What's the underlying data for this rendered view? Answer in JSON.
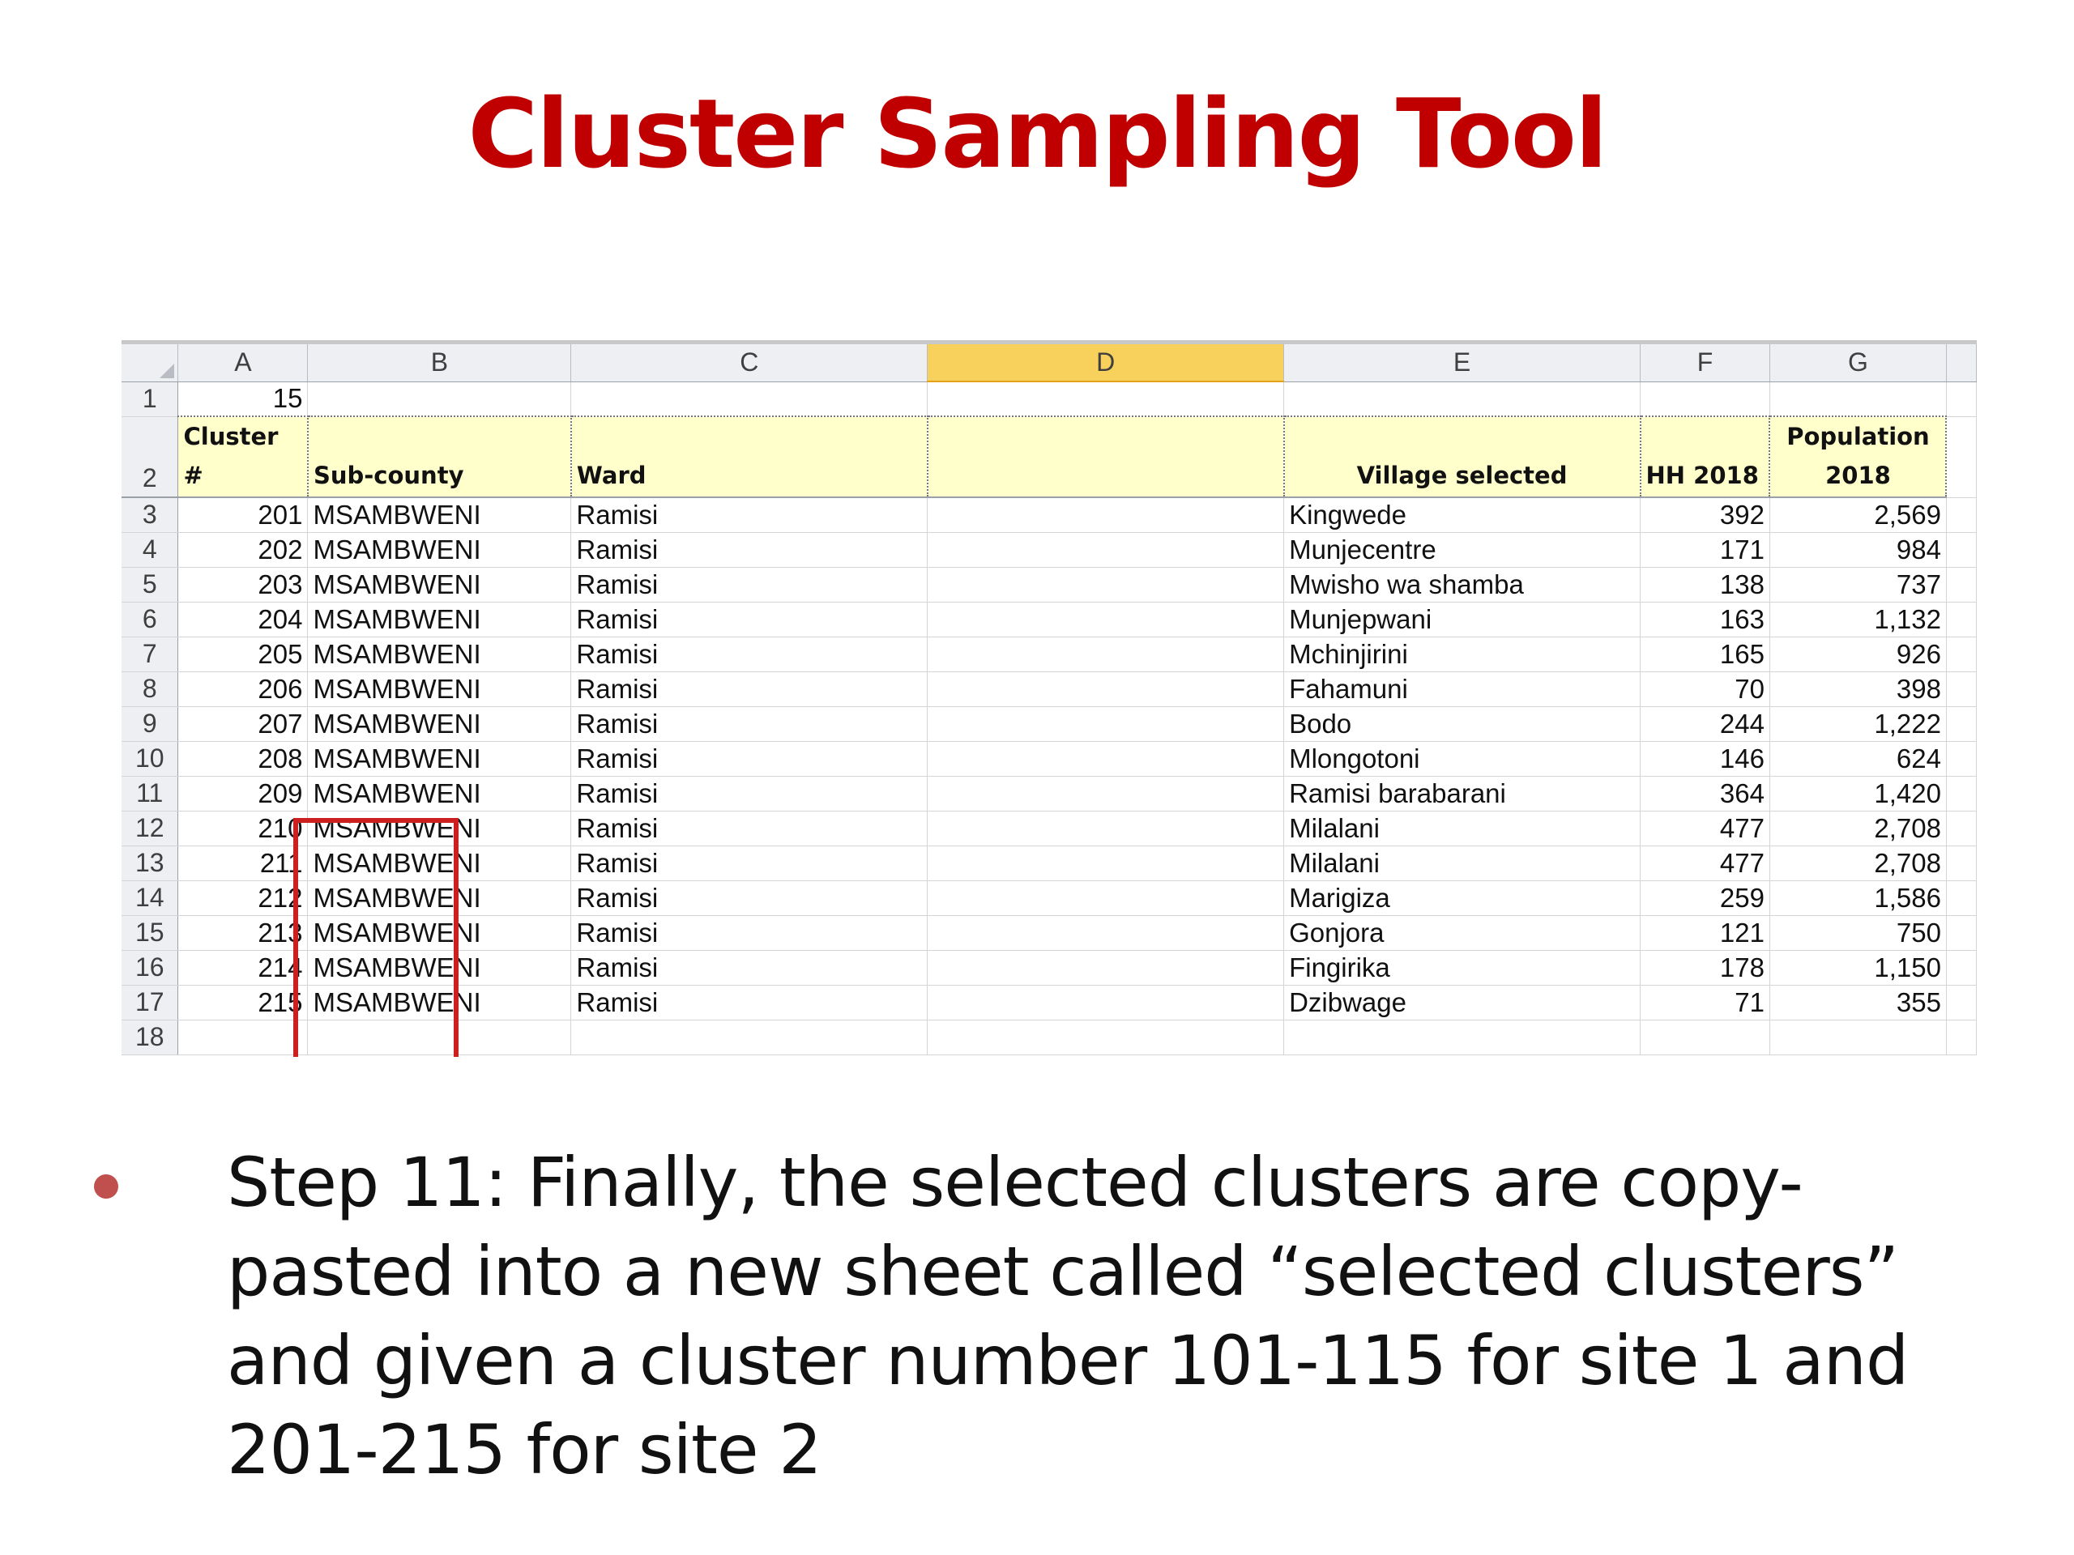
{
  "slide": {
    "title": "Cluster Sampling Tool"
  },
  "spreadsheet": {
    "columns": [
      "A",
      "B",
      "C",
      "D",
      "E",
      "F",
      "G"
    ],
    "selected_column": "D",
    "row1": {
      "row_number": "1",
      "a_value": "15"
    },
    "header_row": {
      "row_number": "2",
      "cluster": "Cluster #",
      "subcounty": "Sub-county",
      "ward": "Ward",
      "blank": "",
      "village": "Village selected",
      "hh": "HH 2018",
      "population": "Population 2018"
    },
    "rows": [
      {
        "row_number": "3",
        "cluster": "201",
        "subcounty": "MSAMBWENI",
        "ward": "Ramisi",
        "village": "Kingwede",
        "hh": "392",
        "population": "2,569"
      },
      {
        "row_number": "4",
        "cluster": "202",
        "subcounty": "MSAMBWENI",
        "ward": "Ramisi",
        "village": "Munjecentre",
        "hh": "171",
        "population": "984"
      },
      {
        "row_number": "5",
        "cluster": "203",
        "subcounty": "MSAMBWENI",
        "ward": "Ramisi",
        "village": "Mwisho wa shamba",
        "hh": "138",
        "population": "737"
      },
      {
        "row_number": "6",
        "cluster": "204",
        "subcounty": "MSAMBWENI",
        "ward": "Ramisi",
        "village": "Munjepwani",
        "hh": "163",
        "population": "1,132"
      },
      {
        "row_number": "7",
        "cluster": "205",
        "subcounty": "MSAMBWENI",
        "ward": "Ramisi",
        "village": "Mchinjirini",
        "hh": "165",
        "population": "926"
      },
      {
        "row_number": "8",
        "cluster": "206",
        "subcounty": "MSAMBWENI",
        "ward": "Ramisi",
        "village": "Fahamuni",
        "hh": "70",
        "population": "398"
      },
      {
        "row_number": "9",
        "cluster": "207",
        "subcounty": "MSAMBWENI",
        "ward": "Ramisi",
        "village": "Bodo",
        "hh": "244",
        "population": "1,222"
      },
      {
        "row_number": "10",
        "cluster": "208",
        "subcounty": "MSAMBWENI",
        "ward": "Ramisi",
        "village": "Mlongotoni",
        "hh": "146",
        "population": "624"
      },
      {
        "row_number": "11",
        "cluster": "209",
        "subcounty": "MSAMBWENI",
        "ward": "Ramisi",
        "village": "Ramisi barabarani",
        "hh": "364",
        "population": "1,420"
      },
      {
        "row_number": "12",
        "cluster": "210",
        "subcounty": "MSAMBWENI",
        "ward": "Ramisi",
        "village": "Milalani",
        "hh": "477",
        "population": "2,708"
      },
      {
        "row_number": "13",
        "cluster": "211",
        "subcounty": "MSAMBWENI",
        "ward": "Ramisi",
        "village": "Milalani",
        "hh": "477",
        "population": "2,708"
      },
      {
        "row_number": "14",
        "cluster": "212",
        "subcounty": "MSAMBWENI",
        "ward": "Ramisi",
        "village": "Marigiza",
        "hh": "259",
        "population": "1,586"
      },
      {
        "row_number": "15",
        "cluster": "213",
        "subcounty": "MSAMBWENI",
        "ward": "Ramisi",
        "village": "Gonjora",
        "hh": "121",
        "population": "750"
      },
      {
        "row_number": "16",
        "cluster": "214",
        "subcounty": "MSAMBWENI",
        "ward": "Ramisi",
        "village": "Fingirika",
        "hh": "178",
        "population": "1,150"
      },
      {
        "row_number": "17",
        "cluster": "215",
        "subcounty": "MSAMBWENI",
        "ward": "Ramisi",
        "village": "Dzibwage",
        "hh": "71",
        "population": "355"
      }
    ],
    "last_row_number": "18",
    "highlight_color": "#cc1f1f"
  },
  "bullet": {
    "text": "Step 11: Finally, the selected clusters are copy-pasted into a new sheet called “selected clusters” and given a cluster number 101-115 for site 1 and 201-215 for site 2",
    "bullet_color": "#c0504d"
  },
  "colors": {
    "title": "#c00000",
    "header_fill": "#ffffcc",
    "selected_column_fill": "#f7d15b"
  }
}
